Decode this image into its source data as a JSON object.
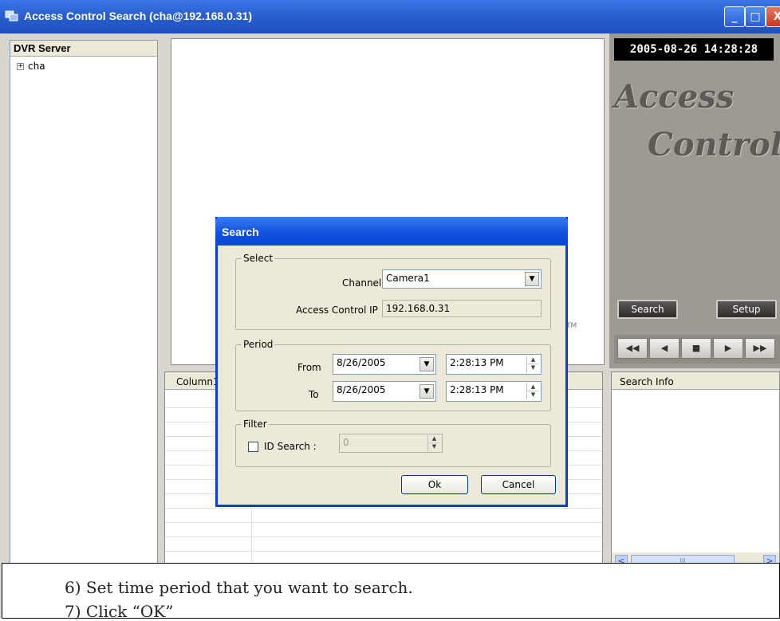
{
  "window": {
    "title": "Access Control Search (cha@192.168.0.31)",
    "controls": {
      "minimize": "_",
      "maximize": "□",
      "close": "X"
    }
  },
  "tree": {
    "header": "DVR Server",
    "node": {
      "expander": "+",
      "label": "cha"
    }
  },
  "video": {
    "trademark": "TM"
  },
  "right_panel": {
    "clock": "2005-08-26 14:28:28",
    "brand_line1": "Access",
    "brand_line2": "Control",
    "search_button": "Search",
    "setup_button": "Setup",
    "transport": [
      "◀◀",
      "◀",
      "■",
      "▶",
      "▶▶"
    ]
  },
  "list": {
    "column1": "Column1"
  },
  "info": {
    "header": "Search Info",
    "scroll_left": "<",
    "scroll_right": ">",
    "scroll_grip": "III"
  },
  "dialog": {
    "title": "Search",
    "select_group": "Select",
    "channel_label": "Channel",
    "channel_value": "Camera1",
    "ip_label": "Access Control IP",
    "ip_value": "192.168.0.31",
    "period_group": "Period",
    "from_label": "From",
    "to_label": "To",
    "from_date": "8/26/2005",
    "from_time": "2:28:13 PM",
    "to_date": "8/26/2005",
    "to_time": "2:28:13 PM",
    "filter_group": "Filter",
    "id_search_label": "ID Search :",
    "id_value": "0",
    "ok": "Ok",
    "cancel": "Cancel"
  },
  "instructions": {
    "line1": "6) Set time period that you want to search.",
    "line2": "7) Click “OK”"
  },
  "colors": {
    "titlebar": "#2a5fd0",
    "dialog_border": "#0a3fd6",
    "panel_gray": "#9d9a93",
    "brand_text": "#5c5a55"
  },
  "icons": {
    "app": "app-window-icon",
    "dropdown": "chevron-down-icon",
    "spin": "spin-arrows-icon"
  }
}
